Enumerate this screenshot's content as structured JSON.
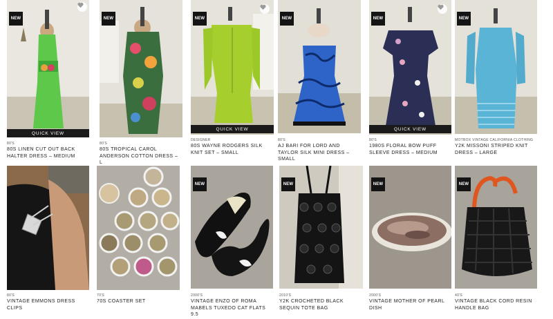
{
  "ui": {
    "new_label": "NEW",
    "quick_view_label": "QUICK VIEW"
  },
  "products": [
    {
      "category": "80'S",
      "title": "80S LINEN CUT OUT BACK HALTER DRESS – MEDIUM",
      "new": true,
      "favorite": true,
      "quick_view": true
    },
    {
      "category": "80'S",
      "title": "80S TROPICAL CAROL ANDERSON COTTON DRESS – L",
      "new": true,
      "favorite": false,
      "quick_view": false
    },
    {
      "category": "DESIGNER",
      "title": "80S WAYNE RODGERS SILK KNIT SET – SMALL",
      "new": true,
      "favorite": true,
      "quick_view": true
    },
    {
      "category": "80'S",
      "title": "AJ BARI FOR LORD AND TAYLOR SILK MINI DRESS – SMALL",
      "new": true,
      "favorite": false,
      "quick_view": false
    },
    {
      "category": "80'S",
      "title": "1980S FLORAL BOW PUFF SLEEVE DRESS – MEDIUM",
      "new": true,
      "favorite": true,
      "quick_view": true
    },
    {
      "category": "MOTBOX VINTAGE CALIFORNIA CLOTHING",
      "title": "Y2K MISSONI STRIPED KNIT DRESS – LARGE",
      "new": true,
      "favorite": false,
      "quick_view": false
    },
    {
      "category": "80'S",
      "title": "VINTAGE EMMONS DRESS CLIPS",
      "new": false,
      "favorite": false,
      "quick_view": false
    },
    {
      "category": "70'S",
      "title": "70S COASTER SET",
      "new": false,
      "favorite": false,
      "quick_view": false
    },
    {
      "category": "2000'S",
      "title": "VINTAGE ENZO OF ROMA MABELS TUXEDO CAT FLATS 9.5",
      "new": true,
      "favorite": false,
      "quick_view": false
    },
    {
      "category": "2010'S",
      "title": "Y2K CROCHETED BLACK SEQUIN TOTE BAG",
      "new": true,
      "favorite": false,
      "quick_view": false
    },
    {
      "category": "2000'S",
      "title": "VINTAGE MOTHER OF PEARL DISH",
      "new": true,
      "favorite": false,
      "quick_view": false
    },
    {
      "category": "40'S",
      "title": "VINTAGE BLACK CORD RESIN HANDLE BAG",
      "new": true,
      "favorite": false,
      "quick_view": false
    }
  ]
}
